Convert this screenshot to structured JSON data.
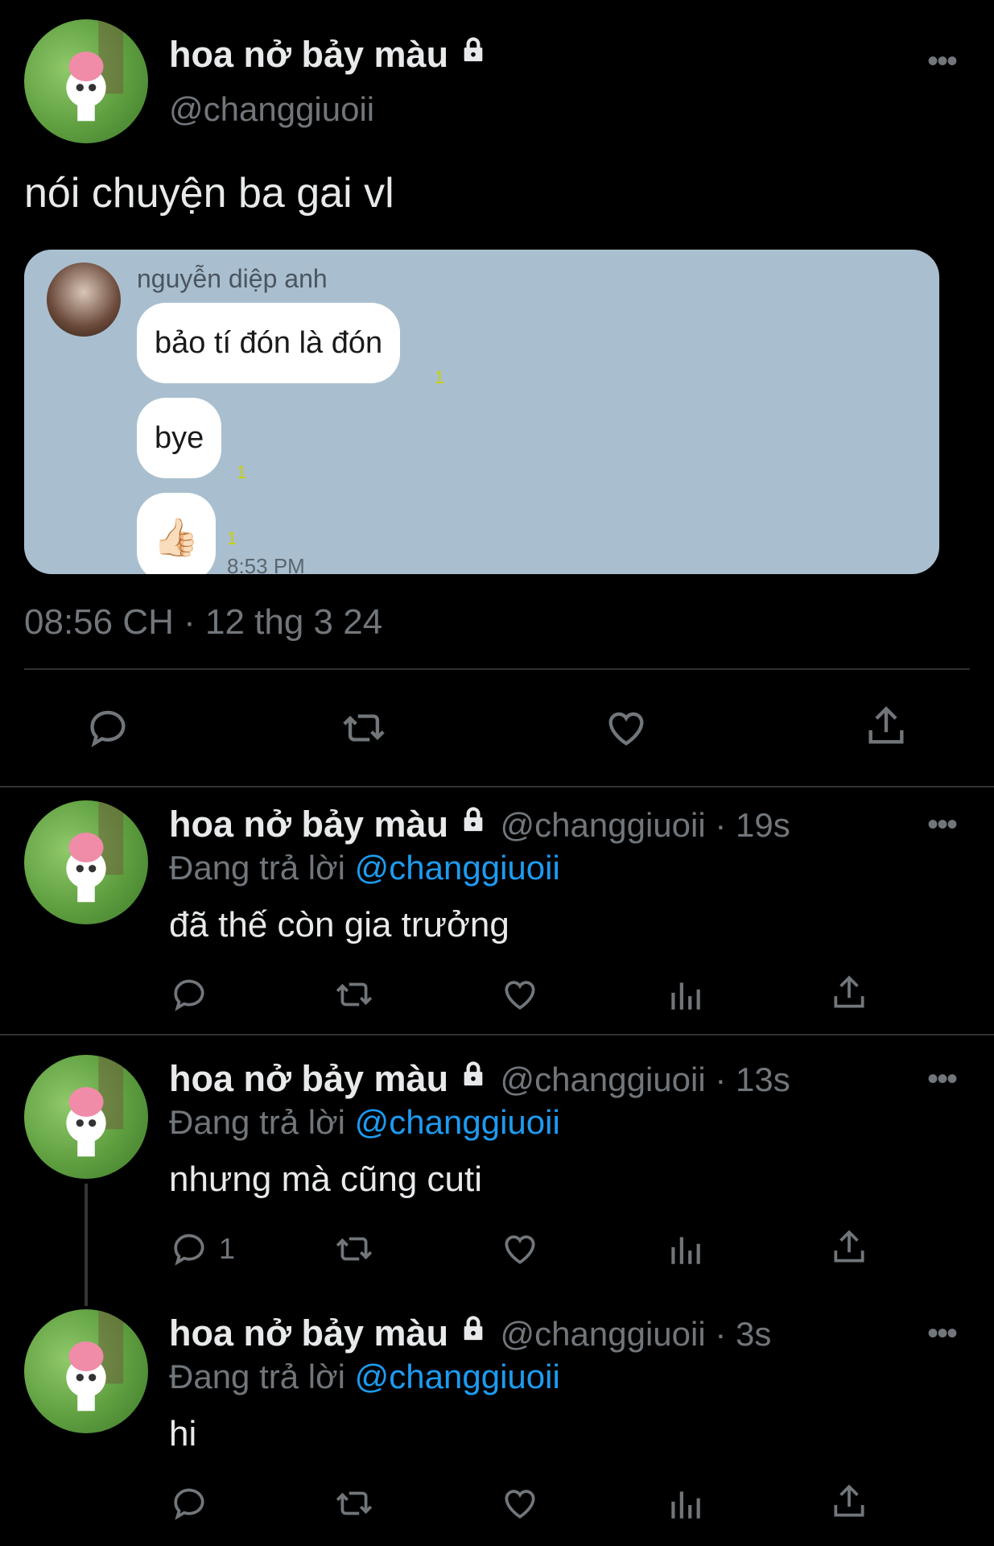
{
  "main_tweet": {
    "display_name": "hoa nở bảy màu",
    "handle": "@changgiuoii",
    "text": "nói chuyện ba gai vl",
    "timestamp": "08:56 CH · 12 thg 3 24",
    "chat_screenshot": {
      "sender_name": "nguyễn diệp anh",
      "messages": [
        {
          "text": "bảo tí đón là đón",
          "read_count": "1"
        },
        {
          "text": "bye",
          "read_count": "1"
        },
        {
          "text": "👍🏻",
          "read_count": "1"
        }
      ],
      "time": "8:53 PM"
    }
  },
  "replies": [
    {
      "display_name": "hoa nở bảy màu",
      "handle_time": "@changgiuoii · 19s",
      "replying_prefix": "Đang trả lời",
      "replying_to": "@changgiuoii",
      "text": "đã thế còn gia trưởng",
      "reply_count": ""
    },
    {
      "display_name": "hoa nở bảy màu",
      "handle_time": "@changgiuoii · 13s",
      "replying_prefix": "Đang trả lời",
      "replying_to": "@changgiuoii",
      "text": "nhưng mà cũng cuti",
      "reply_count": "1"
    },
    {
      "display_name": "hoa nở bảy màu",
      "handle_time": "@changgiuoii · 3s",
      "replying_prefix": "Đang trả lời",
      "replying_to": "@changgiuoii",
      "text": "hi",
      "reply_count": ""
    }
  ],
  "more_glyph": "•••",
  "colors": {
    "background": "#000000",
    "accent": "#1d9bf0",
    "muted": "#71767b",
    "chat_bg": "#a9bfcf"
  },
  "icons": [
    "reply-icon",
    "retweet-icon",
    "like-icon",
    "views-icon",
    "share-icon",
    "lock-icon",
    "more-icon"
  ]
}
